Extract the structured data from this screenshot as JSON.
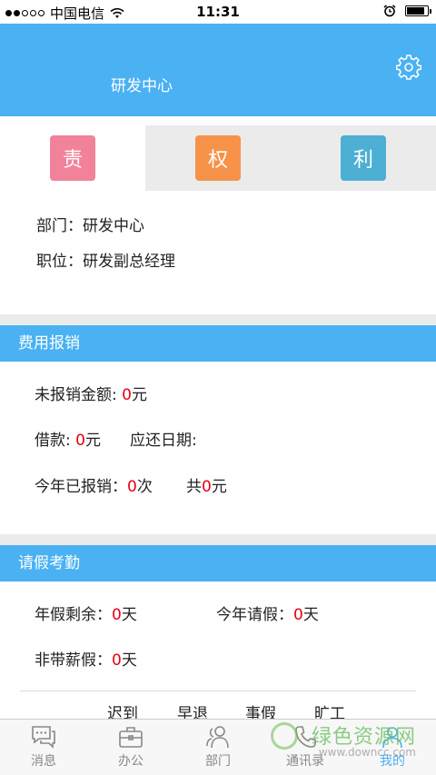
{
  "status_bar": {
    "carrier": "中国电信",
    "time": "11:31"
  },
  "header": {
    "title": "研发中心"
  },
  "tabs": [
    {
      "label": "责",
      "color": "#f2829a"
    },
    {
      "label": "权",
      "color": "#f7924a"
    },
    {
      "label": "利",
      "color": "#4cafd3"
    }
  ],
  "info": {
    "department": "部门：研发中心",
    "position": "职位：研发副总经理"
  },
  "expense": {
    "title": "费用报销",
    "unreimbursed_label": "未报销金额: ",
    "unreimbursed_value": "0",
    "unreimbursed_unit": "元",
    "loan_label": "借款: ",
    "loan_value": "0",
    "loan_unit": "元",
    "due_date_label": "应还日期:",
    "this_year_label": "今年已报销：",
    "this_year_count": "0",
    "this_year_count_unit": "次",
    "total_label": "共",
    "total_value": "0",
    "total_unit": "元"
  },
  "leave": {
    "title": "请假考勤",
    "annual_remaining_label": "年假剩余：",
    "annual_remaining_value": "0",
    "annual_remaining_unit": "天",
    "this_year_leave_label": "今年请假：",
    "this_year_leave_value": "0",
    "this_year_leave_unit": "天",
    "unpaid_label": "非带薪假：",
    "unpaid_value": "0",
    "unpaid_unit": "天",
    "columns": [
      "迟到",
      "早退",
      "事假",
      "旷工"
    ]
  },
  "bottom_nav": [
    {
      "label": "消息",
      "icon": "message-icon"
    },
    {
      "label": "办公",
      "icon": "briefcase-icon"
    },
    {
      "label": "部门",
      "icon": "people-icon"
    },
    {
      "label": "通讯录",
      "icon": "phone-icon"
    },
    {
      "label": "我的",
      "icon": "user-icon"
    }
  ],
  "watermark": {
    "title": "绿色资源网",
    "url": "www.downcc.com"
  },
  "colors": {
    "accent": "#4ab1f3",
    "value_red": "#e60012",
    "gap_gray": "#ebebeb"
  }
}
